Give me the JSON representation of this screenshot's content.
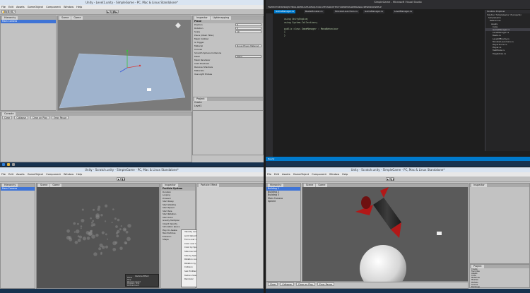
{
  "q1": {
    "title": "Unity - Level1.unity - SimpleGame - PC, Mac & Linux Standalone*",
    "menu": [
      "File",
      "Edit",
      "Assets",
      "GameObject",
      "Component",
      "Window",
      "Help"
    ],
    "hierarchy_tab": "Hierarchy",
    "hierarchy_items": [
      "Main Camera"
    ],
    "scene_tabs": [
      "Scene",
      "Game"
    ],
    "inspector_tabs": [
      "Inspector",
      "Lightmapping"
    ],
    "inspector_object": "Plane",
    "inspector_rows": [
      {
        "label": "Position",
        "value": "0"
      },
      {
        "label": "Rotation",
        "value": "0"
      },
      {
        "label": "Scale",
        "value": "10"
      },
      {
        "label": "Plane (Mesh Filter)",
        "value": ""
      },
      {
        "label": "Mesh Collider",
        "value": ""
      },
      {
        "label": "Is Trigger",
        "value": ""
      },
      {
        "label": "Material",
        "value": "None (Physic Material)"
      },
      {
        "label": "Convex",
        "value": ""
      },
      {
        "label": "Smooth Sphere Collisions",
        "value": ""
      },
      {
        "label": "Mesh",
        "value": "Plane"
      },
      {
        "label": "Mesh Renderer",
        "value": ""
      },
      {
        "label": "Cast Shadows",
        "value": ""
      },
      {
        "label": "Receive Shadows",
        "value": ""
      },
      {
        "label": "Materials",
        "value": ""
      },
      {
        "label": "Use Light Probes",
        "value": ""
      }
    ],
    "project_tab": "Project",
    "project_items": [
      "Create",
      "Favorites",
      "Level1"
    ],
    "console_tabs": [
      "Console"
    ],
    "console_buttons": [
      "Clear",
      "Collapse",
      "Clear on Play",
      "Error Pause"
    ]
  },
  "q2": {
    "title": "SimpleGame - Microsoft Visual Studio",
    "menu": [
      "FILE",
      "EDIT",
      "VIEW",
      "PROJECT",
      "BUILD",
      "DEBUG",
      "TEAM",
      "SQL",
      "TOOLS",
      "TEST",
      "ARCHITECTURE",
      "RESHARPER",
      "ANALYZE",
      "WINDOW",
      "HELP"
    ],
    "tabs": [
      "GameManager.cs",
      "BeatsMonster.cs",
      "MonsterLaunchers.cs",
      "GameManager.cs",
      "LevelManager.cs"
    ],
    "code_lines": [
      "using UnityEngine;",
      "using System.Collections;",
      "",
      "public class GameManager : MonoBehaviour",
      "{",
      "}"
    ],
    "solution_title": "Solution Explorer",
    "solution_items": [
      "Solution 'SimpleGame' (3 projects)",
      "SimpleGame",
      "References",
      "Assets",
      "Code",
      "GameManager.cs",
      "LevelManager.cs",
      "Beats.cs",
      "LevelOfEnemy.cs",
      "MonsterLaunchers.cs",
      "PlayerScore.cs",
      "Player.cs",
      "TestMode.cs",
      "TargetArea.cs"
    ],
    "status": "Ready"
  },
  "q3": {
    "title": "Unity - Scratch.unity - SimpleGame - PC, Mac & Linux Standalone*",
    "menu": [
      "File",
      "Edit",
      "Assets",
      "GameObject",
      "Component",
      "Window",
      "Help"
    ],
    "hierarchy_items": [
      "Main Camera"
    ],
    "scene_tabs": [
      "Scene",
      "Game"
    ],
    "inspector_title": "Particle System",
    "inspector_rows": [
      "Duration",
      "Looping",
      "Prewarm",
      "Start Delay",
      "Start Lifetime",
      "Start Speed",
      "Start Size",
      "Start Rotation",
      "Start Color",
      "Gravity Multiplier",
      "Inherit Velocity",
      "Simulation Space",
      "Play On Awake",
      "Max Particles",
      "Emission",
      "Shape"
    ],
    "menu_popup": [
      "Velocity over Lifetime",
      "Limit Velocity over Lifetime",
      "Force over Lifetime",
      "Color over Lifetime",
      "Color by Speed",
      "Size over Lifetime",
      "Size by Speed",
      "Rotation over Lifetime",
      "Rotation by Speed",
      "Collision",
      "Sub Emitters",
      "Texture Sheet Animation",
      "Renderer"
    ],
    "particle_panel": {
      "title": "Particle Effect",
      "rows": [
        "Pause",
        "Stop",
        "Playback Speed",
        "Playback Time",
        "Particle Count"
      ]
    }
  },
  "q4": {
    "title": "Unity - Scratch.unity - SimpleGame - PC, Mac & Linux Standalone*",
    "menu": [
      "File",
      "Edit",
      "Assets",
      "GameObject",
      "Component",
      "Window",
      "Help"
    ],
    "hierarchy_items": [
      "Building 1",
      "Building 2",
      "Building 3",
      "Main Camera",
      "Sphere"
    ],
    "scene_tabs": [
      "Scene",
      "Game"
    ],
    "inspector_tab": "Inspector",
    "project_items": [
      "Create",
      "Favorites",
      "Assets",
      "Code",
      "Materials",
      "Meshes",
      "Prefabs",
      "Scenes",
      "Buildings"
    ],
    "console_buttons": [
      "Clear",
      "Collapse",
      "Clear on Play",
      "Error Pause"
    ]
  },
  "colors": {
    "unity_bg": "#c2c2c2",
    "vs_bg": "#1e1e1e",
    "vs_accent": "#007acc",
    "taskbar": "#17324f",
    "rocket_red": "#b21818"
  }
}
